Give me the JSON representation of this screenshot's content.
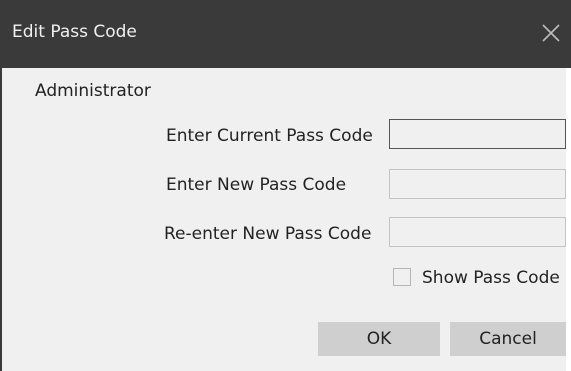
{
  "window": {
    "title": "Edit Pass Code",
    "close_icon": "close-icon"
  },
  "section": {
    "label": "Administrator"
  },
  "fields": {
    "current_label": "Enter Current Pass Code",
    "current_value": "",
    "new_label": "Enter New Pass Code",
    "new_value": "",
    "reenter_label": "Re-enter New Pass Code",
    "reenter_value": ""
  },
  "show_pass_code": {
    "label": "Show Pass Code",
    "checked": false
  },
  "buttons": {
    "ok_label": "OK",
    "cancel_label": "Cancel"
  },
  "colors": {
    "titlebar": "#3a3a3a",
    "body": "#f0f0f0",
    "button": "#cfcfcf"
  }
}
